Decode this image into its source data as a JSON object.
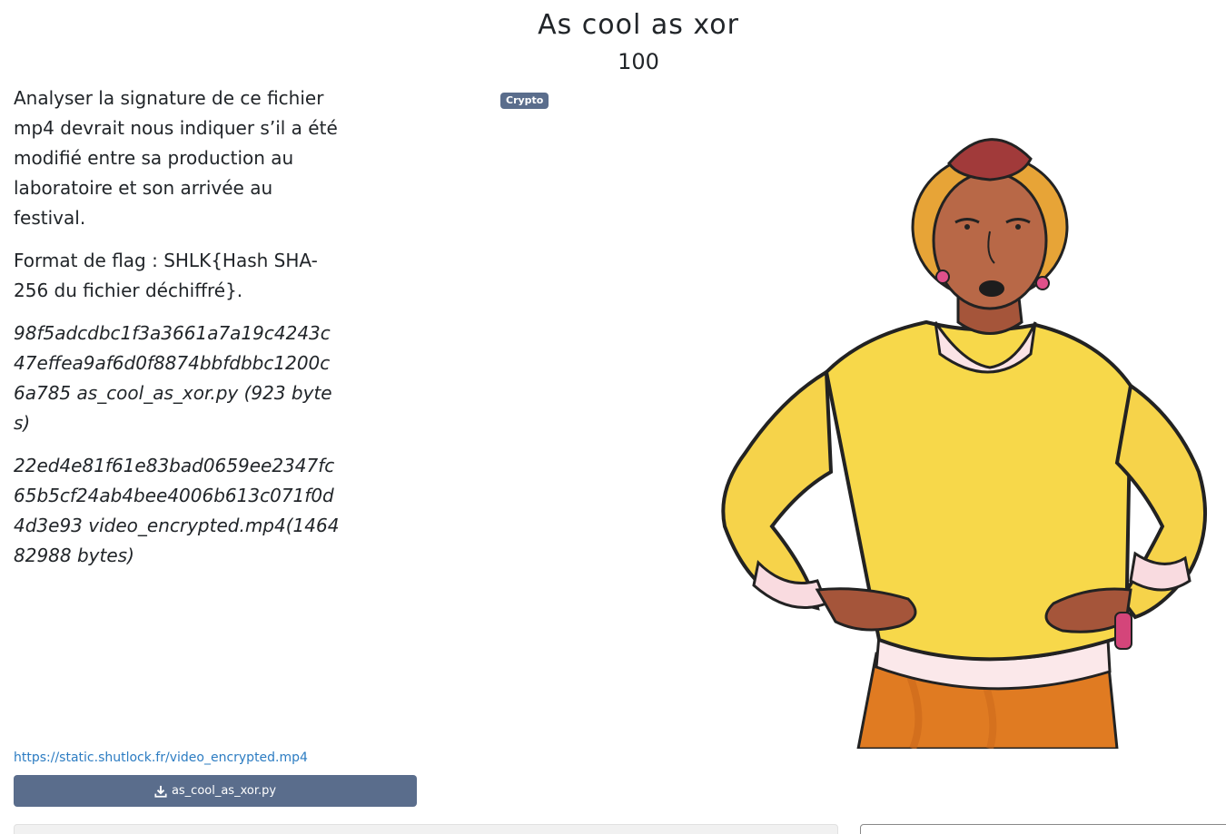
{
  "challenge": {
    "title": "As cool as xor",
    "points": "100",
    "category_badge": "Crypto"
  },
  "description": {
    "paragraph1": "Analyser la signature de ce fichier mp4 devrait nous indiquer s’il a été modifié entre sa production au laboratoire et son arrivée au festival.",
    "paragraph2": "Format de flag : SHLK{Hash SHA-256 du fichier déchiffré}.",
    "hash1": "98f5adcdbc1f3a3661a7a19c4243c47effea9af6d0f8874bbfdbbc1200c6a785 as_cool_as_xor.py (923 bytes)",
    "hash2": "22ed4e81f61e83bad0659ee2347fc65b5cf24ab4bee4006b613c071f0d4d3e93 video_encrypted.mp4(146482988 bytes)"
  },
  "files": {
    "link_text": "https://static.shutlock.fr/video_encrypted.mp4",
    "download_label": "as_cool_as_xor.py",
    "download_icon": "download-icon"
  },
  "colors": {
    "badge": "#5a6d8c",
    "button": "#5a6d8c",
    "link": "#2c7cc2"
  }
}
